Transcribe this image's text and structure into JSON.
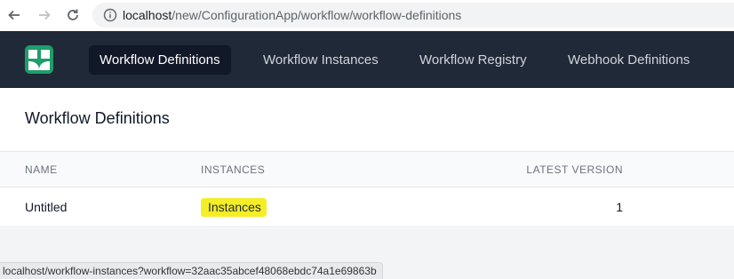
{
  "browser": {
    "url_host": "localhost",
    "url_path": "/new/ConfigurationApp/workflow/workflow-definitions",
    "back_icon": "arrow-left-icon",
    "forward_icon": "arrow-right-icon",
    "reload_icon": "reload-icon",
    "info_icon": "info-icon",
    "status_url": "localhost/workflow-instances?workflow=32aac35abcef48068ebdc74a1e69863b"
  },
  "header": {
    "logo_icon": "elsa-logo-icon",
    "nav": [
      {
        "label": "Workflow Definitions",
        "active": true
      },
      {
        "label": "Workflow Instances",
        "active": false
      },
      {
        "label": "Workflow Registry",
        "active": false
      },
      {
        "label": "Webhook Definitions",
        "active": false
      }
    ]
  },
  "main": {
    "title": "Workflow Definitions",
    "table": {
      "columns": [
        "NAME",
        "INSTANCES",
        "LATEST VERSION"
      ],
      "rows": [
        {
          "name": "Untitled",
          "instances": "Instances",
          "latest_version": "1"
        }
      ]
    }
  },
  "colors": {
    "header_bg": "#1f2937",
    "accent": "#10b981",
    "highlight": "#f5ee26"
  }
}
